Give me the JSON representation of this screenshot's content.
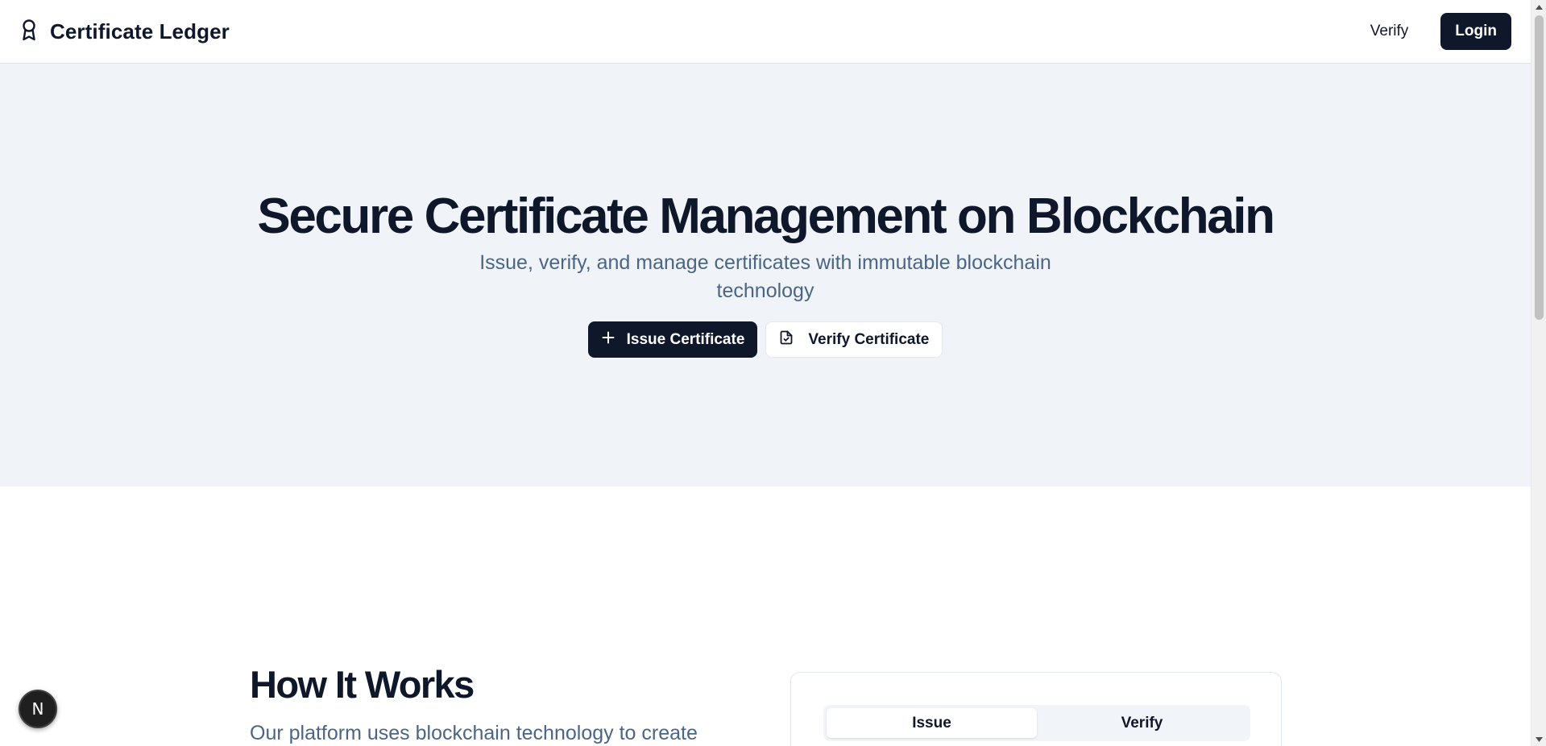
{
  "header": {
    "brand_name": "Certificate Ledger",
    "nav_verify": "Verify",
    "login_label": "Login"
  },
  "hero": {
    "title": "Secure Certificate Management on Blockchain",
    "subtitle": "Issue, verify, and manage certificates with immutable blockchain technology",
    "issue_button": "Issue Certificate",
    "verify_button": "Verify Certificate"
  },
  "how": {
    "title": "How It Works",
    "description": "Our platform uses blockchain technology to create",
    "tabs": [
      {
        "label": "Issue",
        "active": true
      },
      {
        "label": "Verify",
        "active": false
      }
    ]
  },
  "badge": {
    "letter": "N"
  },
  "icons": {
    "brand": "award-icon",
    "issue": "plus-icon",
    "verify": "file-check-icon"
  },
  "colors": {
    "primary": "#0f172a",
    "hero_bg": "#f0f4f8",
    "muted_text": "#4a6585",
    "border": "#e2e8f0"
  }
}
